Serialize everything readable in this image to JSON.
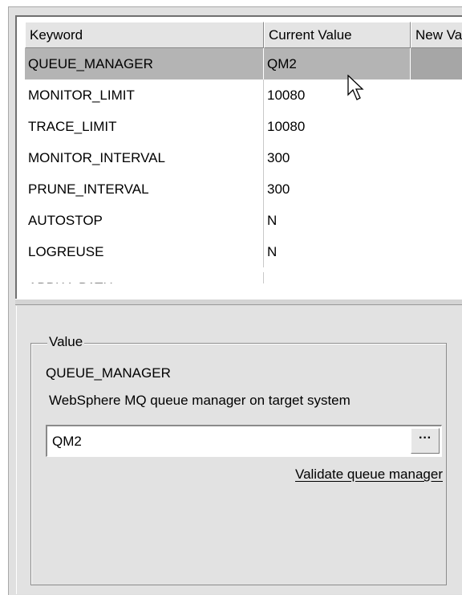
{
  "table": {
    "columns": [
      "Keyword",
      "Current Value",
      "New Value"
    ],
    "rows": [
      {
        "keyword": "QUEUE_MANAGER",
        "current": "QM2",
        "new": ""
      },
      {
        "keyword": "MONITOR_LIMIT",
        "current": "10080",
        "new": ""
      },
      {
        "keyword": "TRACE_LIMIT",
        "current": "10080",
        "new": ""
      },
      {
        "keyword": "MONITOR_INTERVAL",
        "current": "300",
        "new": ""
      },
      {
        "keyword": "PRUNE_INTERVAL",
        "current": "300",
        "new": ""
      },
      {
        "keyword": "AUTOSTOP",
        "current": "N",
        "new": ""
      },
      {
        "keyword": "LOGREUSE",
        "current": "N",
        "new": ""
      },
      {
        "keyword": "APPLY_PATH",
        "current": "",
        "new": ""
      }
    ],
    "selected_row": 0
  },
  "value_panel": {
    "group_label": "Value",
    "keyword": "QUEUE_MANAGER",
    "description": "WebSphere MQ queue manager on target system",
    "input_value": "QM2",
    "browse_label": "···",
    "validate_link": "Validate queue manager"
  },
  "icons": {
    "cursor": "mouse-pointer-icon"
  }
}
